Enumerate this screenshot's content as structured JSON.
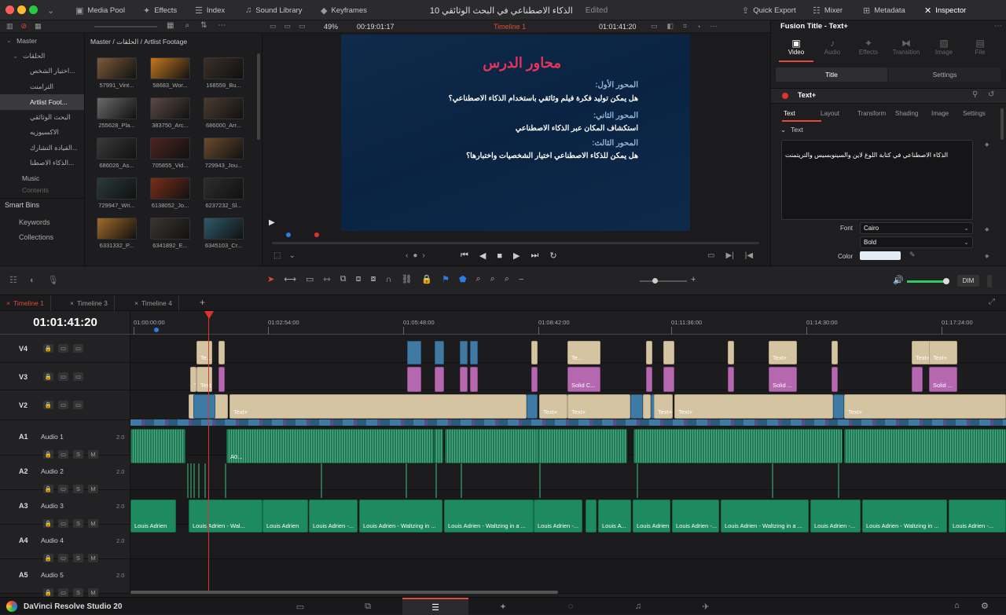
{
  "window": {
    "title": "الذكاء الاصطناعي في البحث الوثائقي 10",
    "status": "Edited"
  },
  "topbar": {
    "left_items": [
      {
        "label": "Media Pool",
        "icon": "media-pool-icon"
      },
      {
        "label": "Effects",
        "icon": "effects-icon"
      },
      {
        "label": "Index",
        "icon": "index-icon"
      },
      {
        "label": "Sound Library",
        "icon": "sound-library-icon"
      },
      {
        "label": "Keyframes",
        "icon": "keyframes-icon"
      }
    ],
    "right_items": [
      {
        "label": "Quick Export",
        "icon": "export-icon"
      },
      {
        "label": "Mixer",
        "icon": "mixer-icon"
      },
      {
        "label": "Metadata",
        "icon": "metadata-icon"
      },
      {
        "label": "Inspector",
        "icon": "inspector-icon"
      }
    ]
  },
  "viewer_bar": {
    "zoom": "49%",
    "source_timecode": "00:19:01:17",
    "timeline_name": "Timeline 1",
    "record_timecode": "01:01:41:20"
  },
  "bins": {
    "items": [
      {
        "label": "Master"
      },
      {
        "label": "الحلقات"
      },
      {
        "label": "اختيار الشخص..."
      },
      {
        "label": "الترامنت"
      },
      {
        "label": "Artlist Foot..."
      },
      {
        "label": "البحث الوثائقي"
      },
      {
        "label": "الاكسيوزيه"
      },
      {
        "label": "القيادة التشارك..."
      },
      {
        "label": "الذكاء الاصطنا..."
      },
      {
        "label": "Music"
      },
      {
        "label": "Contents"
      }
    ],
    "smart_bins_title": "Smart Bins",
    "smart_bins": [
      "Keywords",
      "Collections"
    ]
  },
  "media": {
    "breadcrumb": "Master / الحلقات / Artlist Footage",
    "clips": [
      {
        "label": "57991_Vint...",
        "color": "#7b5a3a"
      },
      {
        "label": "58683_Wor...",
        "color": "#c2781f"
      },
      {
        "label": "168559_Bu...",
        "color": "#3b2f28"
      },
      {
        "label": "255628_Pla...",
        "color": "#6a6a6a"
      },
      {
        "label": "383750_Arc...",
        "color": "#5a4a45"
      },
      {
        "label": "686000_Arr...",
        "color": "#4a3b30"
      },
      {
        "label": "686026_As...",
        "color": "#3a3a3a"
      },
      {
        "label": "705855_Vid...",
        "color": "#4c2420"
      },
      {
        "label": "729943_Jou...",
        "color": "#6b4a2e"
      },
      {
        "label": "729947_Wri...",
        "color": "#2a3a3a"
      },
      {
        "label": "6138052_Jo...",
        "color": "#7a2e1a"
      },
      {
        "label": "6237232_Sl...",
        "color": "#2d2d2d"
      },
      {
        "label": "6331332_P...",
        "color": "#a06b2a"
      },
      {
        "label": "6341892_E...",
        "color": "#3a3530"
      },
      {
        "label": "6345103_Cr...",
        "color": "#2e5a6a"
      }
    ]
  },
  "viewer": {
    "heading": "محاور الدرس",
    "axes": [
      {
        "title": "المحور الأول:",
        "text": "هل يمكن توليد فكرة فيلم وثائقي باستخدام الذكاء الاصطناعي؟"
      },
      {
        "title": "المحور الثاني:",
        "text": "استكشاف المكان عبر الذكاء الاصطناعي"
      },
      {
        "title": "المحور الثالث:",
        "text": "هل يمكن للذكاء الاصطناعي اختيار الشخصيات واختبارها؟"
      }
    ]
  },
  "inspector": {
    "title": "Fusion Title - Text+",
    "top_tabs": [
      "Video",
      "Audio",
      "Effects",
      "Transition",
      "Image",
      "File"
    ],
    "sub_tabs": [
      "Title",
      "Settings"
    ],
    "node_title": "Text+",
    "text_tabs": [
      "Text",
      "Layout",
      "Transform",
      "Shading",
      "Image",
      "Settings"
    ],
    "section": "Text",
    "text_value": "الذكاء الاصطناعي في كتابة اللوغ لاين والسينوبسيس والتريتمنت",
    "font_label": "Font",
    "font_value": "Cairo",
    "style_value": "Bold",
    "color_label": "Color"
  },
  "timeline_toolbar": {
    "dim_label": "DIM"
  },
  "timeline_tabs": [
    "Timeline 1",
    "Timeline 3",
    "Timeline 4"
  ],
  "timecode": "01:01:41:20",
  "ruler": [
    "01:00:00:00",
    "01:02:54:00",
    "01:05:48:00",
    "01:08:42:00",
    "01:11:36:00",
    "01:14:30:00",
    "01:17:24:00"
  ],
  "tracks": {
    "video": [
      {
        "name": "V4"
      },
      {
        "name": "V3"
      },
      {
        "name": "V2"
      }
    ],
    "audio": [
      {
        "name": "A1",
        "label": "Audio 1",
        "ch": "2.0"
      },
      {
        "name": "A2",
        "label": "Audio 2",
        "ch": "2.0"
      },
      {
        "name": "A3",
        "label": "Audio 3",
        "ch": "2.0"
      },
      {
        "name": "A4",
        "label": "Audio 4",
        "ch": "2.0"
      },
      {
        "name": "A5",
        "label": "Audio 5",
        "ch": "2.0"
      }
    ]
  },
  "clip_labels": {
    "title_short": "Te...",
    "title_plus": "Text+",
    "text_short": "Text",
    "solid": "Solid C...",
    "solid_short": "Solid ...",
    "a0": "A0...",
    "louis": "Louis Adrien",
    "louis_wal": "Louis Adrien - Wal...",
    "louis_dash": "Louis Adrien -...",
    "louis_waltz": "Louis Adrien - Waltzing in ...",
    "louis_waltz2": "Louis Adrien - Waltzing in a ...",
    "louis_a": "Louis A..."
  },
  "footer": {
    "app_name": "DaVinci Resolve Studio 20"
  },
  "colors": {
    "accent": "#e24b36",
    "title_clip": "#d5c4a1",
    "solid_clip": "#b567b0",
    "video_clip": "#3f7aa5",
    "audio_clip": "#1f7a55"
  }
}
